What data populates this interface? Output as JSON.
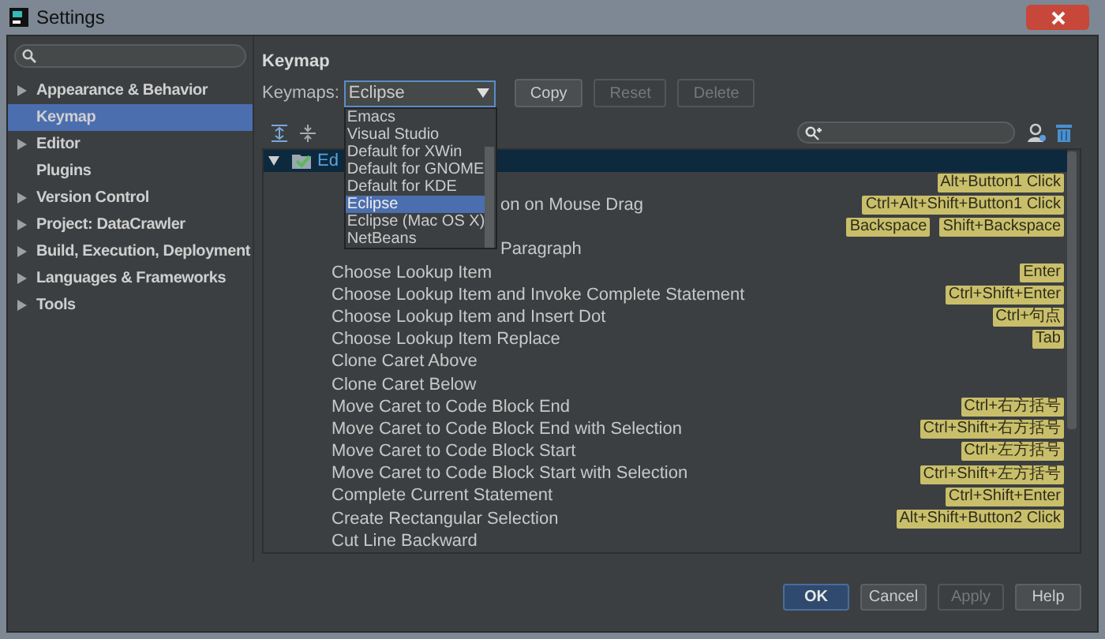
{
  "window": {
    "title": "Settings"
  },
  "sidebar": {
    "items": [
      {
        "label": "Appearance & Behavior",
        "expandable": true,
        "selected": false
      },
      {
        "label": "Keymap",
        "expandable": false,
        "selected": true
      },
      {
        "label": "Editor",
        "expandable": true,
        "selected": false
      },
      {
        "label": "Plugins",
        "expandable": false,
        "selected": false
      },
      {
        "label": "Version Control",
        "expandable": true,
        "selected": false
      },
      {
        "label": "Project: DataCrawler",
        "expandable": true,
        "selected": false
      },
      {
        "label": "Build, Execution, Deployment",
        "expandable": true,
        "selected": false
      },
      {
        "label": "Languages & Frameworks",
        "expandable": true,
        "selected": false
      },
      {
        "label": "Tools",
        "expandable": true,
        "selected": false
      }
    ]
  },
  "page_title": "Keymap",
  "keymap_selector": {
    "label": "Keymaps:",
    "value": "Eclipse",
    "expanded": true,
    "options": [
      {
        "label": "Emacs",
        "selected": false
      },
      {
        "label": "Visual Studio",
        "selected": false
      },
      {
        "label": "Default for XWin",
        "selected": false
      },
      {
        "label": "Default for GNOME",
        "selected": false
      },
      {
        "label": "Default for KDE",
        "selected": false
      },
      {
        "label": "Eclipse",
        "selected": true
      },
      {
        "label": "Eclipse (Mac OS X)",
        "selected": false
      },
      {
        "label": "NetBeans",
        "selected": false
      }
    ]
  },
  "buttons": [
    {
      "label": "Copy",
      "disabled": false
    },
    {
      "label": "Reset",
      "disabled": true
    },
    {
      "label": "Delete",
      "disabled": true
    }
  ],
  "tree": {
    "root": {
      "label": "Ed",
      "expanded": true,
      "selected": true
    },
    "rows": [
      {
        "kind": "hidden",
        "shortcuts": [
          "Alt+Button1 Click"
        ]
      },
      {
        "kind": "clipped",
        "name": "on on Mouse Drag",
        "shortcuts": [
          "Ctrl+Alt+Shift+Button1 Click"
        ]
      },
      {
        "kind": "hidden",
        "shortcuts": [
          "Backspace",
          "Shift+Backspace"
        ]
      },
      {
        "kind": "clipped",
        "name": "Paragraph",
        "shortcuts": []
      },
      {
        "kind": "full",
        "name": "Choose Lookup Item",
        "shortcuts": [
          "Enter"
        ]
      },
      {
        "kind": "full",
        "name": "Choose Lookup Item and Invoke Complete Statement",
        "shortcuts": [
          "Ctrl+Shift+Enter"
        ]
      },
      {
        "kind": "full",
        "name": "Choose Lookup Item and Insert Dot",
        "shortcuts": [
          "Ctrl+句点"
        ]
      },
      {
        "kind": "full",
        "name": "Choose Lookup Item Replace",
        "shortcuts": [
          "Tab"
        ]
      },
      {
        "kind": "full",
        "name": "Clone Caret Above",
        "shortcuts": []
      },
      {
        "kind": "full",
        "name": "Clone Caret Below",
        "shortcuts": []
      },
      {
        "kind": "full",
        "name": "Move Caret to Code Block End",
        "shortcuts": [
          "Ctrl+右方括号"
        ]
      },
      {
        "kind": "full",
        "name": "Move Caret to Code Block End with Selection",
        "shortcuts": [
          "Ctrl+Shift+右方括号"
        ]
      },
      {
        "kind": "full",
        "name": "Move Caret to Code Block Start",
        "shortcuts": [
          "Ctrl+左方括号"
        ]
      },
      {
        "kind": "full",
        "name": "Move Caret to Code Block Start with Selection",
        "shortcuts": [
          "Ctrl+Shift+左方括号"
        ]
      },
      {
        "kind": "full",
        "name": "Complete Current Statement",
        "shortcuts": [
          "Ctrl+Shift+Enter"
        ]
      },
      {
        "kind": "full",
        "name": "Create Rectangular Selection",
        "shortcuts": [
          "Alt+Shift+Button2 Click"
        ]
      },
      {
        "kind": "full",
        "name": "Cut Line Backward",
        "shortcuts": []
      }
    ]
  },
  "dialog_buttons": [
    {
      "label": "OK",
      "kind": "default"
    },
    {
      "label": "Cancel",
      "kind": "normal"
    },
    {
      "label": "Apply",
      "kind": "disabled"
    },
    {
      "label": "Help",
      "kind": "normal"
    }
  ]
}
